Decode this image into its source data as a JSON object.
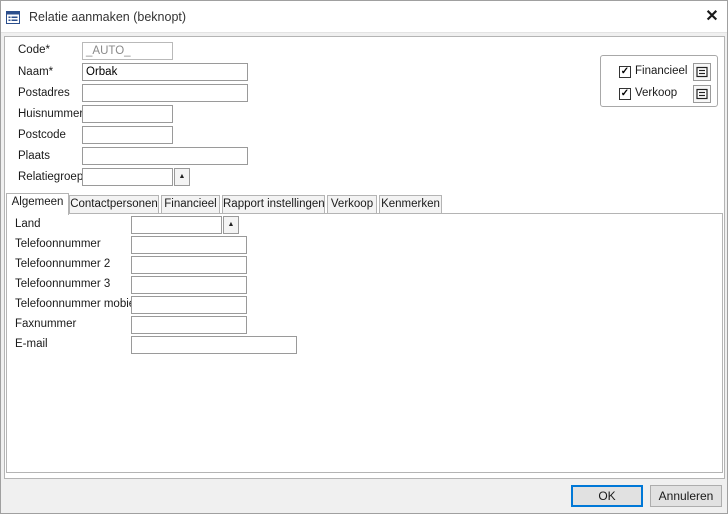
{
  "window": {
    "title": "Relatie aanmaken (beknopt)",
    "close_glyph": "✕"
  },
  "header": {
    "code_label": "Code*",
    "code_value": "_AUTO_",
    "naam_label": "Naam*",
    "naam_value": "Orbak",
    "postadres_label": "Postadres",
    "postadres_value": "",
    "huisnummer_label": "Huisnummer",
    "huisnummer_value": "",
    "postcode_label": "Postcode",
    "postcode_value": "",
    "plaats_label": "Plaats",
    "plaats_value": "",
    "relatiegroep_label": "Relatiegroep",
    "relatiegroep_value": "",
    "spin_glyph": "▲"
  },
  "options": {
    "financieel_label": "Financieel",
    "financieel_checked": true,
    "verkoop_label": "Verkoop",
    "verkoop_checked": true,
    "check_glyph": "✓"
  },
  "tabs": [
    {
      "label": "Algemeen",
      "active": true
    },
    {
      "label": "Contactpersonen",
      "active": false
    },
    {
      "label": "Financieel",
      "active": false
    },
    {
      "label": "Rapport instellingen",
      "active": false
    },
    {
      "label": "Verkoop",
      "active": false
    },
    {
      "label": "Kenmerken",
      "active": false
    }
  ],
  "algemeen": {
    "land_label": "Land",
    "land_value": "",
    "telefoon_label": "Telefoonnummer",
    "telefoon_value": "",
    "telefoon2_label": "Telefoonnummer 2",
    "telefoon2_value": "",
    "telefoon3_label": "Telefoonnummer 3",
    "telefoon3_value": "",
    "mobiel_label": "Telefoonnummer mobiel",
    "mobiel_value": "",
    "fax_label": "Faxnummer",
    "fax_value": "",
    "email_label": "E-mail",
    "email_value": ""
  },
  "footer": {
    "ok_label": "OK",
    "cancel_label": "Annuleren"
  },
  "colors": {
    "default_button_border": "#0078d7",
    "window_bg": "#f0f0f0",
    "icon_blue": "#2b4e8c"
  },
  "icons": {
    "title": "form-list-icon",
    "detail": "detail-form-icon"
  }
}
